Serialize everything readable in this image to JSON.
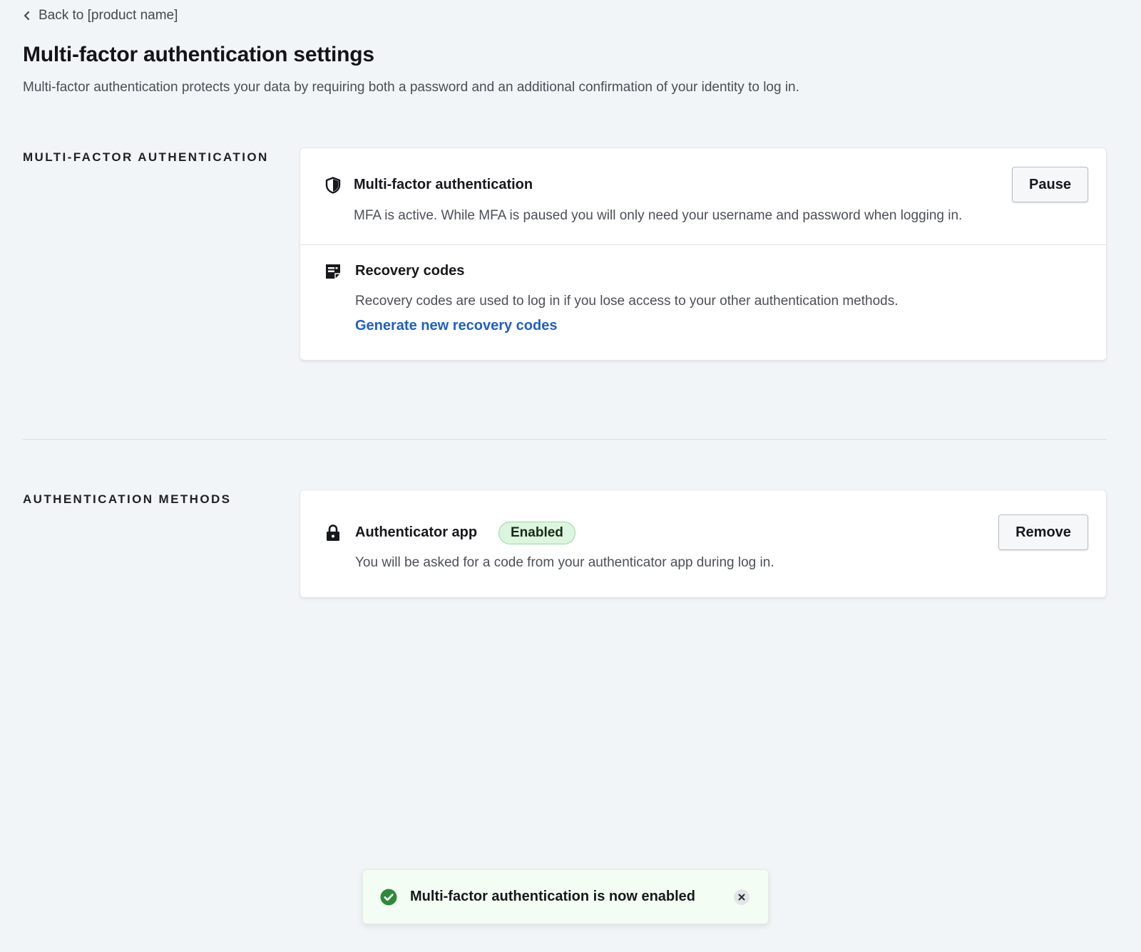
{
  "header": {
    "back_label": "Back to [product name]",
    "title": "Multi-factor authentication settings",
    "description": "Multi-factor authentication protects your data by requiring both a password and an additional confirmation of your identity to log in."
  },
  "mfa_section": {
    "label": "MULTI-FACTOR AUTHENTICATION",
    "mfa": {
      "icon": "shield-icon",
      "title": "Multi-factor authentication",
      "description": "MFA is active. While MFA is paused you will only need your username and password when logging in.",
      "button_label": "Pause"
    },
    "recovery": {
      "icon": "recovery-codes-icon",
      "title": "Recovery codes",
      "description": "Recovery codes are used to log in if you lose access to your other authentication methods.",
      "link_label": "Generate new recovery codes"
    }
  },
  "methods_section": {
    "label": "AUTHENTICATION METHODS",
    "authenticator": {
      "icon": "lock-icon",
      "title": "Authenticator app",
      "status": "Enabled",
      "description": "You will be asked for a code from your authenticator app during log in.",
      "button_label": "Remove"
    }
  },
  "toast": {
    "icon": "check-circle-icon",
    "message": "Multi-factor authentication is now enabled",
    "close_icon": "close-icon"
  },
  "colors": {
    "background": "#f2f5f8",
    "link": "#1f5fc7",
    "success": "#2e8a3a",
    "badge_bg": "#dcf5de",
    "toast_bg": "#f4fdf3"
  }
}
